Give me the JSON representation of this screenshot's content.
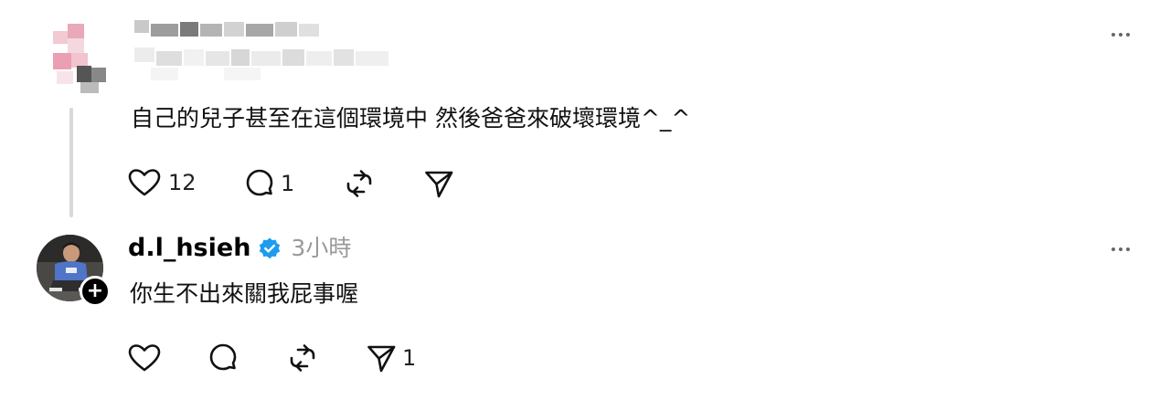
{
  "post1": {
    "text": "自己的兒子甚至在這個環境中 然後爸爸來破壞環境^_^",
    "like_count": "12",
    "reply_count": "1"
  },
  "post2": {
    "username": "d.l_hsieh",
    "timestamp": "3小時",
    "text": "你生不出來關我屁事喔",
    "share_count": "1"
  },
  "icons": {
    "like": "heart-icon",
    "reply": "comment-bubble-icon",
    "repost": "repost-icon",
    "share": "send-icon",
    "more": "more-dots-icon",
    "verified": "verified-badge-icon",
    "follow": "plus-icon"
  },
  "colors": {
    "verified": "#1d9bf0",
    "muted_text": "#999999",
    "thread_line": "#d8d8d8"
  }
}
